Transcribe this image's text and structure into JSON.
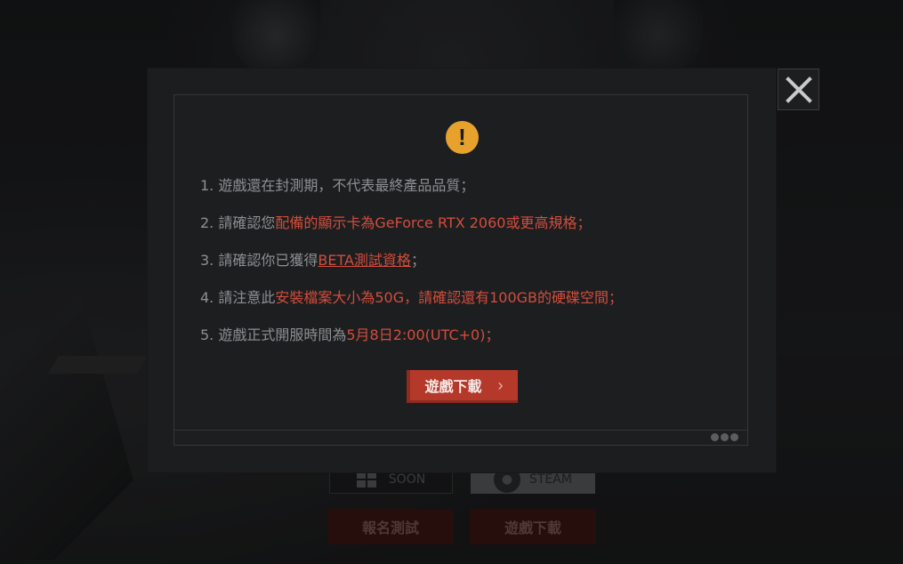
{
  "background": {
    "store_windows_label": "SOON",
    "store_steam_label": "STEAM",
    "signup_button": "報名測試",
    "download_button": "遊戲下載"
  },
  "modal": {
    "warning_icon_glyph": "!",
    "notes": [
      {
        "parts": [
          {
            "text": "1. 遊戲還在封測期，不代表最終產品品質；",
            "style": "normal"
          }
        ]
      },
      {
        "parts": [
          {
            "text": "2. 請確認您",
            "style": "normal"
          },
          {
            "text": "配備的顯示卡為GeForce RTX 2060或更高規格；",
            "style": "highlight"
          }
        ]
      },
      {
        "parts": [
          {
            "text": "3. 請確認你已獲得",
            "style": "normal"
          },
          {
            "text": "BETA測試資格",
            "style": "link"
          },
          {
            "text": "；",
            "style": "normal"
          }
        ]
      },
      {
        "parts": [
          {
            "text": "4. 請注意此",
            "style": "normal"
          },
          {
            "text": "安裝檔案大小為50G，請確認還有100GB的硬碟空間；",
            "style": "highlight"
          }
        ]
      },
      {
        "parts": [
          {
            "text": "5. 遊戲正式開服時間為",
            "style": "normal"
          },
          {
            "text": "5月8日2:00(UTC+0)；",
            "style": "highlight"
          }
        ]
      }
    ],
    "download_button_label": "遊戲下載",
    "download_chevron": "›",
    "close_label": "✕"
  },
  "colors": {
    "highlight": "#d24d3c",
    "warning": "#e7a22d",
    "primary_button": "#b5392b"
  }
}
